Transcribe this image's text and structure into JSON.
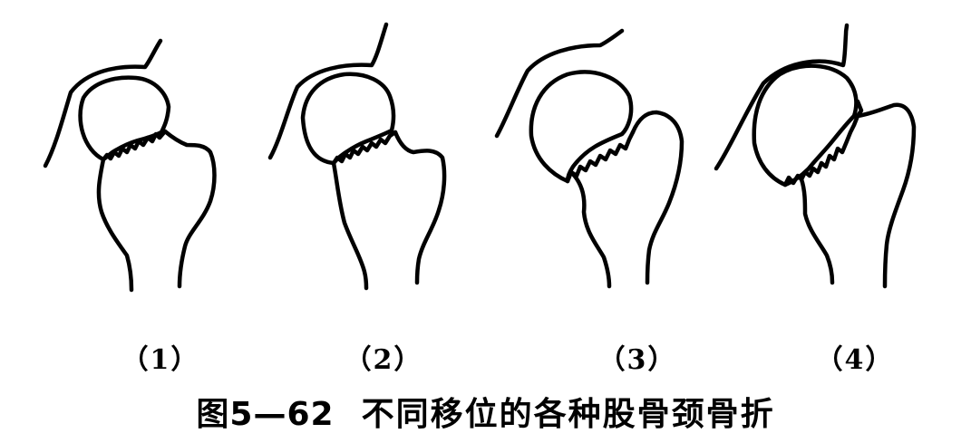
{
  "figure": {
    "panels": [
      {
        "label": "（1）",
        "icon": "femoral-neck-fracture-no-displacement"
      },
      {
        "label": "（2）",
        "icon": "femoral-neck-fracture-slight-displacement"
      },
      {
        "label": "（3）",
        "icon": "femoral-neck-fracture-moderate-displacement"
      },
      {
        "label": "（4）",
        "icon": "femoral-neck-fracture-complete-displacement"
      }
    ],
    "caption_number": "图5—62",
    "caption_text": "不同移位的各种股骨颈骨折",
    "line_color": "#000000",
    "background": "#ffffff"
  }
}
